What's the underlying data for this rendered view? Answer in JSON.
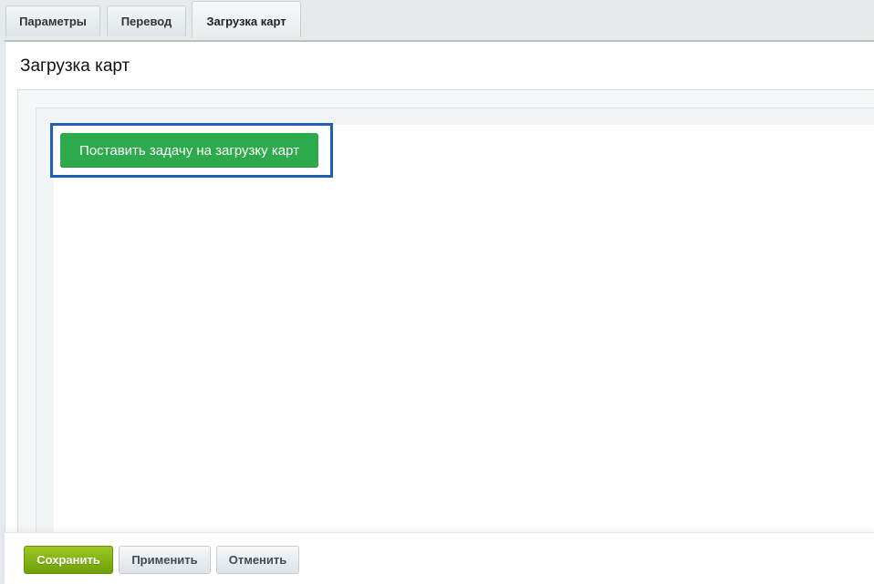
{
  "tabs": [
    {
      "label": "Параметры",
      "active": false
    },
    {
      "label": "Перевод",
      "active": false
    },
    {
      "label": "Загрузка карт",
      "active": true
    }
  ],
  "panel": {
    "title": "Загрузка карт",
    "action_button": "Поставить задачу на загрузку карт"
  },
  "footer": {
    "save_label": "Сохранить",
    "apply_label": "Применить",
    "cancel_label": "Отменить"
  },
  "colors": {
    "action_green": "#2daa4b",
    "save_green": "#7fae12",
    "highlight_blue": "#1f5fb8"
  }
}
